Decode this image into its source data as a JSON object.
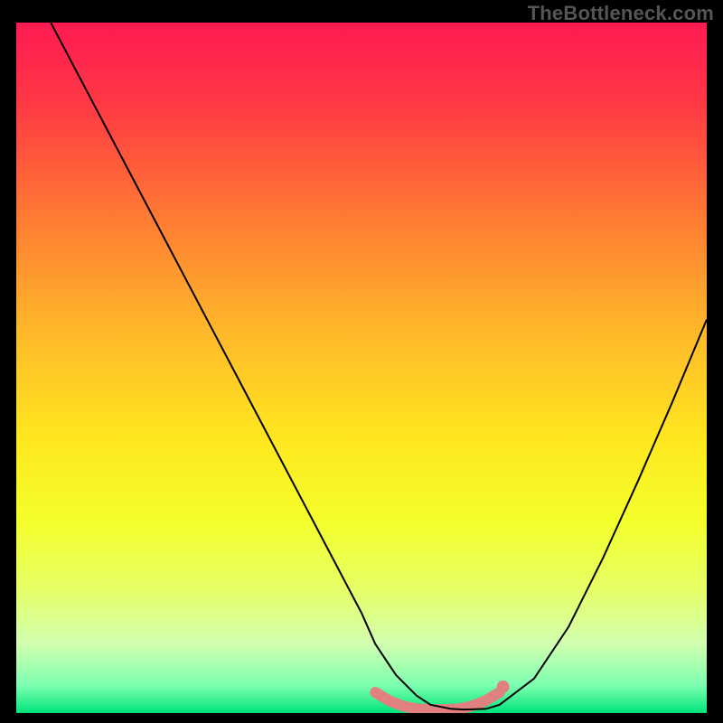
{
  "watermark": "TheBottleneck.com",
  "chart_data": {
    "type": "line",
    "title": "",
    "xlabel": "",
    "ylabel": "",
    "xlim": [
      0,
      100
    ],
    "ylim": [
      0,
      100
    ],
    "background_gradient": {
      "stops": [
        {
          "offset": 0.0,
          "color": "#ff1a52"
        },
        {
          "offset": 0.12,
          "color": "#ff3944"
        },
        {
          "offset": 0.28,
          "color": "#ff7a33"
        },
        {
          "offset": 0.45,
          "color": "#ffb92a"
        },
        {
          "offset": 0.6,
          "color": "#ffe61f"
        },
        {
          "offset": 0.72,
          "color": "#f4ff2a"
        },
        {
          "offset": 0.82,
          "color": "#e6ff66"
        },
        {
          "offset": 0.9,
          "color": "#d1ffb0"
        },
        {
          "offset": 0.96,
          "color": "#7cffb0"
        },
        {
          "offset": 1.0,
          "color": "#00e47a"
        }
      ]
    },
    "series": [
      {
        "name": "bottleneck-curve",
        "color": "#000000",
        "width": 2,
        "x": [
          5,
          10,
          15,
          20,
          25,
          30,
          35,
          40,
          45,
          50,
          52,
          55,
          58,
          60,
          63,
          65,
          68,
          70,
          75,
          80,
          85,
          90,
          95,
          100
        ],
        "values": [
          100,
          90.5,
          81,
          71.5,
          62,
          52.5,
          43,
          33.5,
          24,
          14.5,
          10,
          5.5,
          2.5,
          1.2,
          0.6,
          0.5,
          0.6,
          1.2,
          5,
          12.5,
          22.5,
          33.5,
          45,
          57
        ]
      }
    ],
    "flat_zone": {
      "name": "optimal-range",
      "color": "#e08080",
      "width": 12,
      "x": [
        52,
        54,
        56,
        58,
        60,
        62,
        64,
        66,
        68,
        70
      ],
      "values": [
        3.0,
        1.8,
        1.0,
        0.6,
        0.5,
        0.5,
        0.6,
        1.0,
        1.8,
        3.0
      ]
    },
    "marker": {
      "name": "current-point",
      "color": "#e08080",
      "radius": 7,
      "x": 70.5,
      "value": 3.8
    }
  }
}
